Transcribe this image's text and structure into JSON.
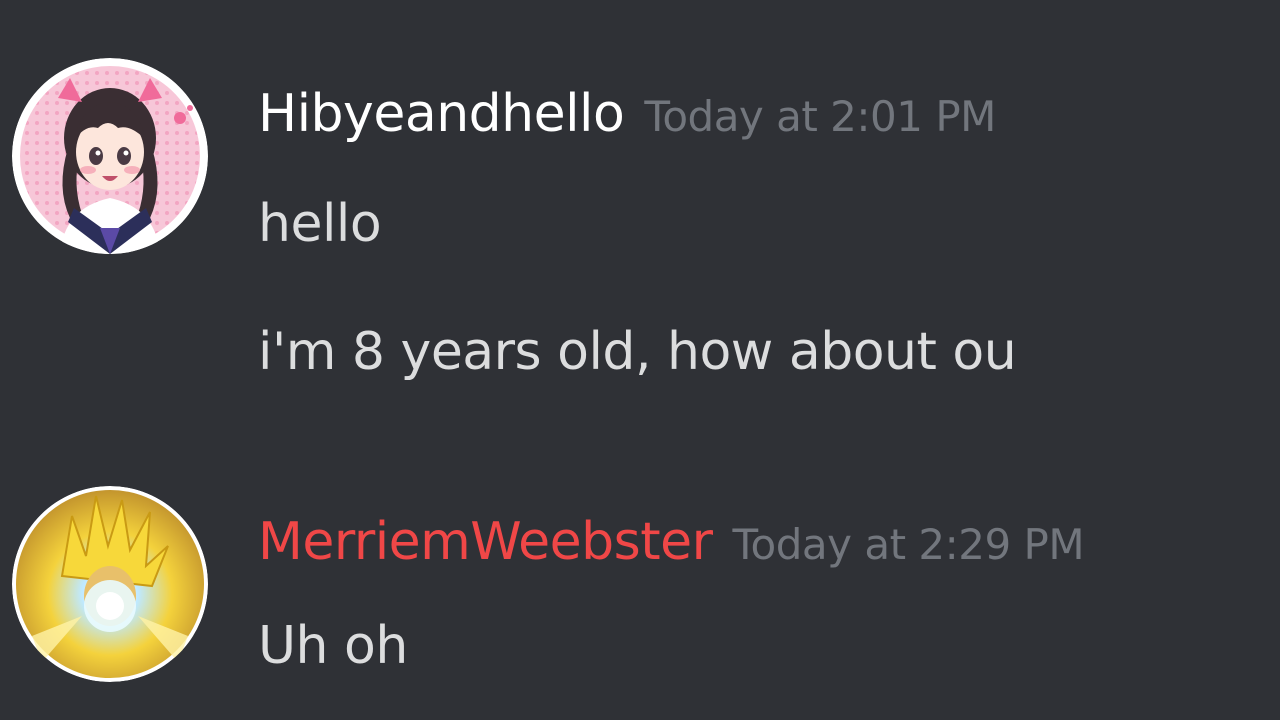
{
  "colors": {
    "background": "#2f3136",
    "username_default": "#ffffff",
    "username_role": "#f04747",
    "timestamp": "#72767d",
    "message_text": "#dcddde"
  },
  "messages": [
    {
      "author": "Hibyeandhello",
      "timestamp": "Today at 2:01 PM",
      "avatar_icon": "anime-girl-avatar",
      "lines": [
        "hello",
        "i'm 8 years old, how about ou"
      ]
    },
    {
      "author": "MerriemWeebster",
      "timestamp": "Today at 2:29 PM",
      "avatar_icon": "super-saiyan-avatar",
      "lines": [
        "Uh oh"
      ]
    }
  ]
}
